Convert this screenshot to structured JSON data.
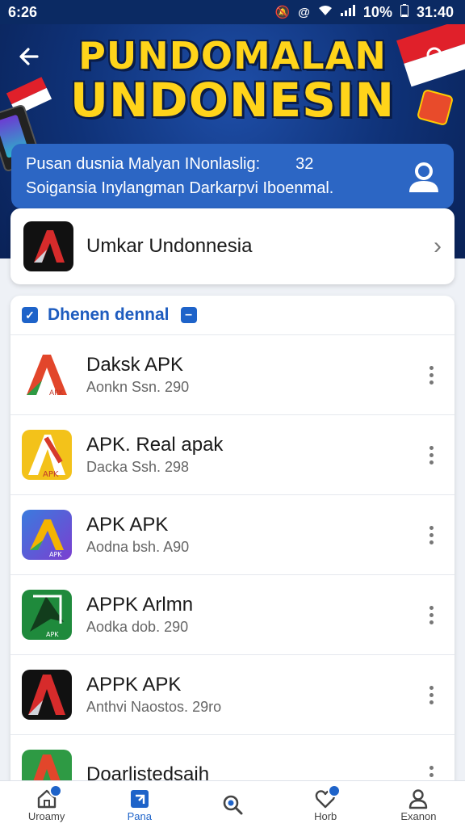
{
  "status_bar": {
    "time": "6:26",
    "battery": "10%",
    "clock": "31:40"
  },
  "header": {
    "title_line1": "PUNDOMALAN",
    "title_line2": "UNDONESIN",
    "info_line1": "Pusan dusnia Malyan INonlaslig:",
    "info_count": "32",
    "info_line2": "Soigansia Inylangman Darkarpvi Iboenmal."
  },
  "featured": {
    "label": "Umkar Undonnesia"
  },
  "list": {
    "title": "Dhenen dennal",
    "items": [
      {
        "name": "Daksk APK",
        "meta": "Aonkn Ssn. 290"
      },
      {
        "name": "APK. Real apak",
        "meta": "Dacka Ssh. 298"
      },
      {
        "name": "APK APK",
        "meta": "Aodna bsh. A90"
      },
      {
        "name": "APPK Arlmn",
        "meta": "Aodka dob. 290"
      },
      {
        "name": "APPK APK",
        "meta": "Anthvi Naostos. 29ro"
      },
      {
        "name": "Doarlistedsaih",
        "meta": ""
      }
    ]
  },
  "bottom_nav": [
    {
      "label": "Uroamy",
      "icon": "home-icon"
    },
    {
      "label": "Pana",
      "icon": "apps-icon"
    },
    {
      "label": "",
      "icon": "search-icon"
    },
    {
      "label": "Horb",
      "icon": "heart-icon"
    },
    {
      "label": "Exanon",
      "icon": "profile-icon"
    }
  ],
  "colors": {
    "header_bg": "#0f3278",
    "title": "#ffd41a",
    "accent": "#1e63c9"
  }
}
